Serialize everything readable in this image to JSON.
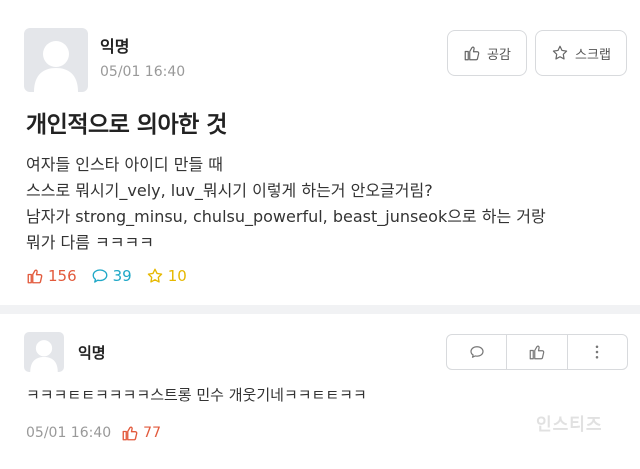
{
  "post": {
    "author": "익명",
    "date": "05/01 16:40",
    "like_label": "공감",
    "scrap_label": "스크랩",
    "title": "개인적으로 의아한 것",
    "body": [
      "여자들 인스타 아이디 만들 때",
      "스스로 뭐시기_vely, luv_뭐시기 이렇게 하는거 안오글거림?",
      "남자가 strong_minsu, chulsu_powerful, beast_junseok으로 하는 거랑",
      "뭐가 다름 ㅋㅋㅋㅋ"
    ],
    "stats": {
      "likes": "156",
      "comments": "39",
      "scraps": "10"
    }
  },
  "comment": {
    "author": "익명",
    "text": "ㅋㅋㅋㅌㅌㅋㅋㅋㅋ스트롱 민수 개웃기네ㅋㅋㅌㅌㅋㅋ",
    "date": "05/01 16:40",
    "likes": "77"
  },
  "watermark": "인스티즈",
  "colors": {
    "like": "#e25a3c",
    "comment": "#20a8c7",
    "scrap": "#e6b800",
    "avatar_bg": "#e4e6ea"
  },
  "icons": {
    "like": "thumbs-up-icon",
    "comment": "speech-bubble-icon",
    "scrap": "star-icon",
    "more": "vertical-dots-icon"
  }
}
